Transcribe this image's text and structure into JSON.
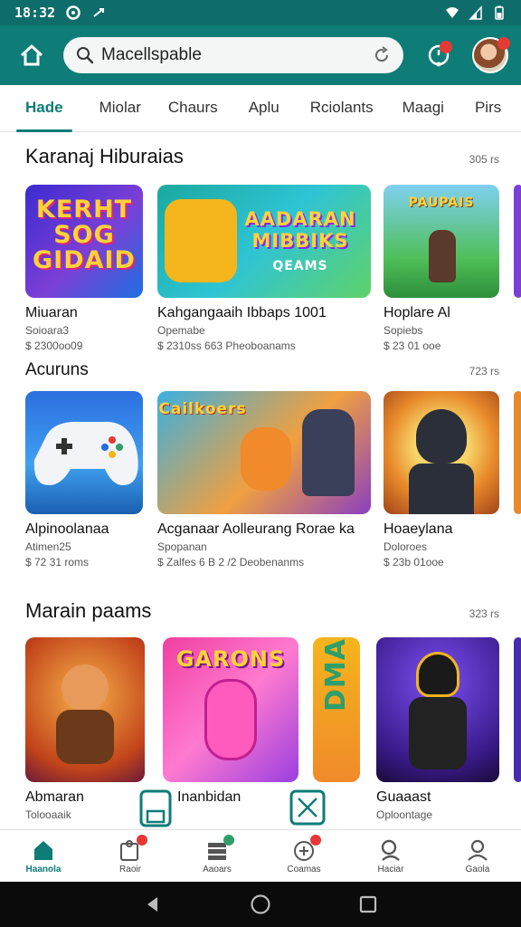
{
  "status": {
    "time": "18:32"
  },
  "search": {
    "value": "Macellspable"
  },
  "tabs": [
    "Hade",
    "Miolar",
    "Chaurs",
    "Aplu",
    "Rciolants",
    "Maagi",
    "Pirs"
  ],
  "sections": [
    {
      "title": "Karanaj Hiburaias",
      "more": "305 rs",
      "cards": [
        {
          "art_text": "KERHT SOG GIDAID",
          "title": "Miuaran",
          "sub1": "Soioara3",
          "sub2": "$ 2300oo09"
        },
        {
          "art_text": "AADARAN MIBBIKS",
          "art_text2": "QEAMS",
          "title": "Kahgangaaih Ibbaps 1001",
          "sub1": "Opemabe",
          "sub2": "$ 2310ss 663 Pheoboanams"
        },
        {
          "art_text": "PAUPAIS",
          "title": "Hoplare Al",
          "sub1": "Sopiebs",
          "sub2": "$ 23 01 ooe"
        }
      ]
    },
    {
      "title": "Acuruns",
      "more": "723 rs",
      "cards": [
        {
          "art_text": "",
          "title": "Alpinoolanaa",
          "sub1": "Atimen25",
          "sub2": "$ 72 31 roms"
        },
        {
          "art_text": "Cailkoers",
          "title": "Acganaar Aolleurang Rorae ka",
          "sub1": "Spopanan",
          "sub2": "$ Zalfes 6 B 2 /2 Deobenanms"
        },
        {
          "art_text": "",
          "title": "Hoaeylana",
          "sub1": "Doloroes",
          "sub2": "$ 23b 01ooe"
        }
      ]
    },
    {
      "title": "Marain paams",
      "more": "323 rs",
      "cards": [
        {
          "art_text": "",
          "title": "Abmaran",
          "sub1": "Tolooaaik"
        },
        {
          "art_text": "GARONS",
          "title": "Inanbidan"
        },
        {
          "art_text": "DMA"
        },
        {
          "art_text": "",
          "title": "Guaaast",
          "sub1": "Oploontage"
        }
      ]
    }
  ],
  "bottom_nav": [
    "Haanola",
    "Raoir",
    "Aaoars",
    "Coamas",
    "Haciar",
    "Gaola"
  ],
  "colors": {
    "primary": "#0e7c77",
    "status_bar": "#0e6d6a",
    "badge": "#e53935"
  }
}
